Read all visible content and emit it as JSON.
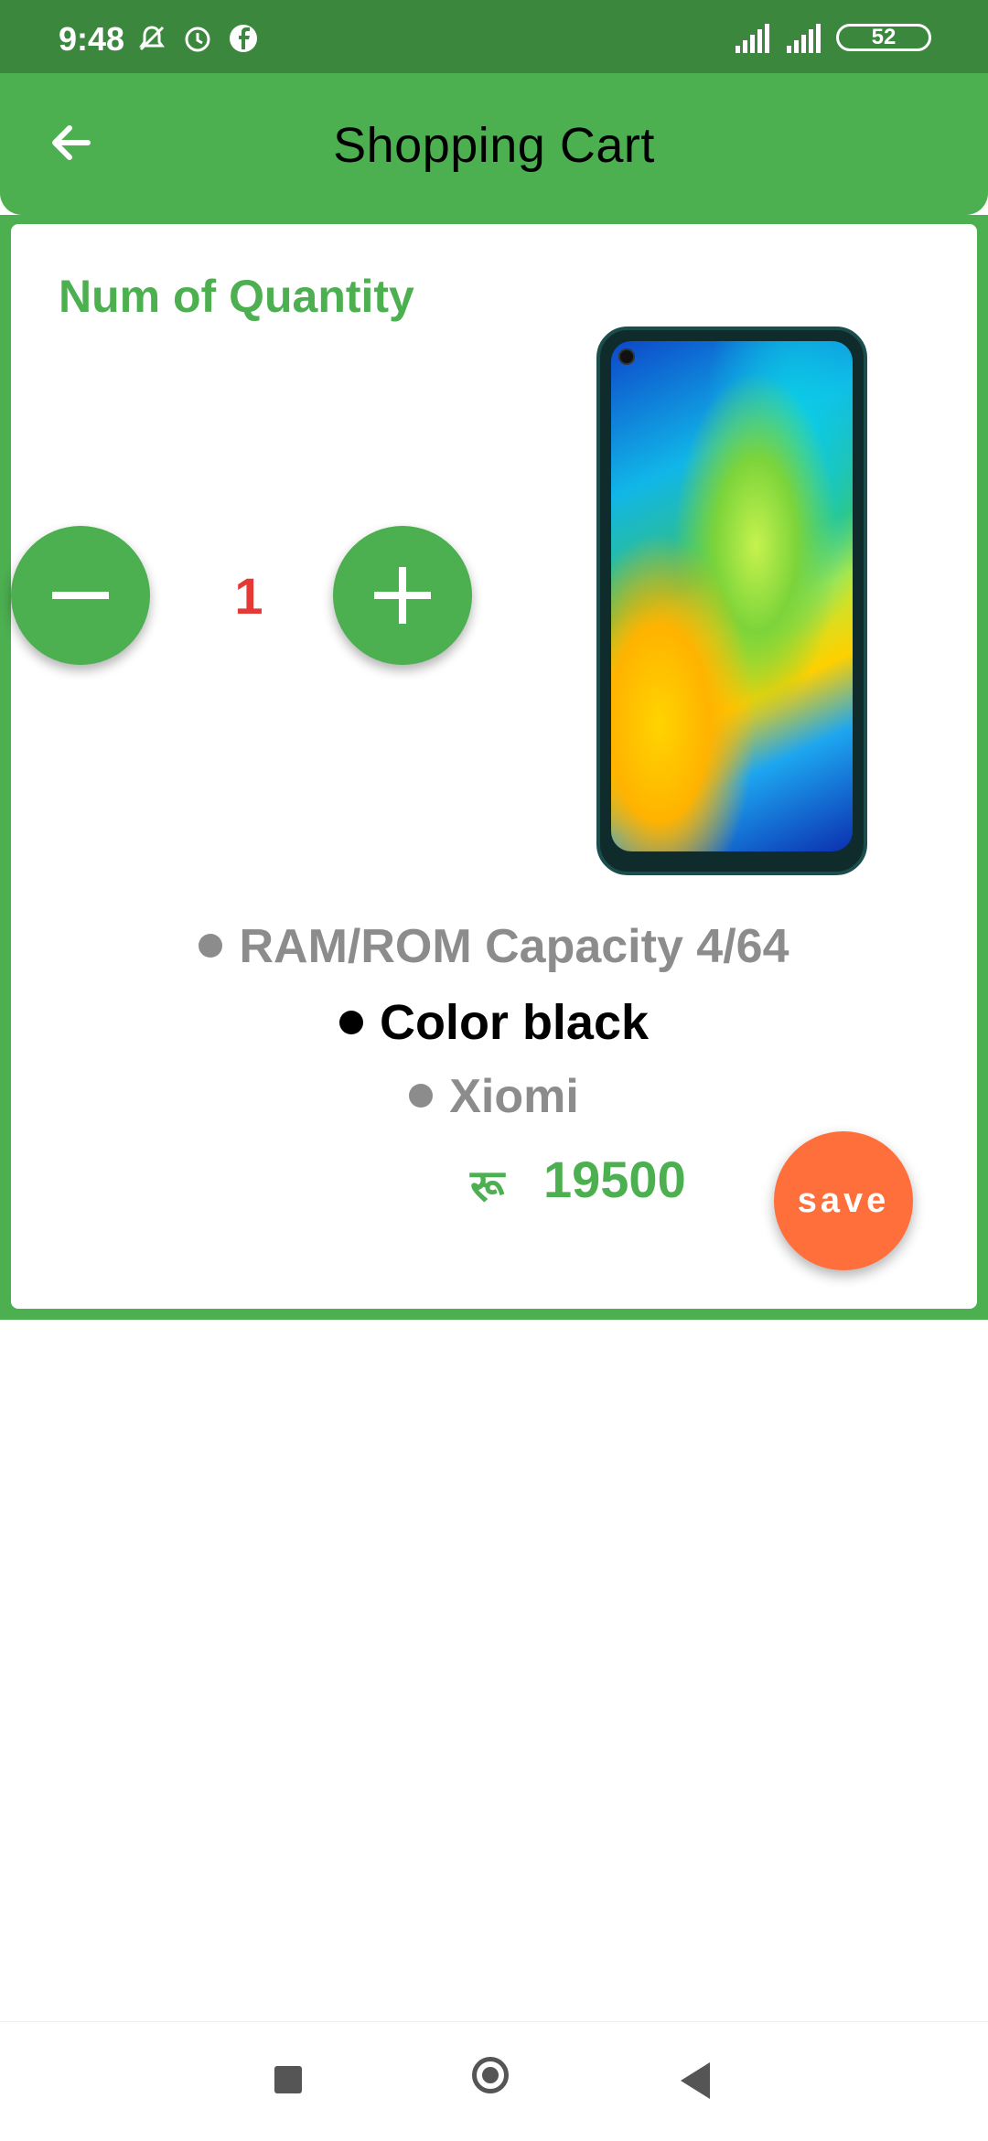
{
  "status_bar": {
    "time": "9:48",
    "battery": "52"
  },
  "app_bar": {
    "title": "Shopping Cart"
  },
  "cart": {
    "section_title": "Num of Quantity",
    "quantity": "1",
    "specs": {
      "ram_rom": "RAM/ROM Capacity  4/64",
      "color": "Color black",
      "brand": "Xiomi"
    },
    "price_currency": "रू",
    "price": "19500",
    "save_label": "save"
  },
  "colors": {
    "primary": "#4caf50",
    "status_bar": "#3b873e",
    "quantity_text": "#e53935",
    "save_button": "#ff6f3c"
  },
  "icons": [
    "back-arrow-icon",
    "minus-icon",
    "plus-icon",
    "mute-icon",
    "alarm-icon",
    "facebook-icon",
    "signal-icon",
    "battery-icon"
  ]
}
